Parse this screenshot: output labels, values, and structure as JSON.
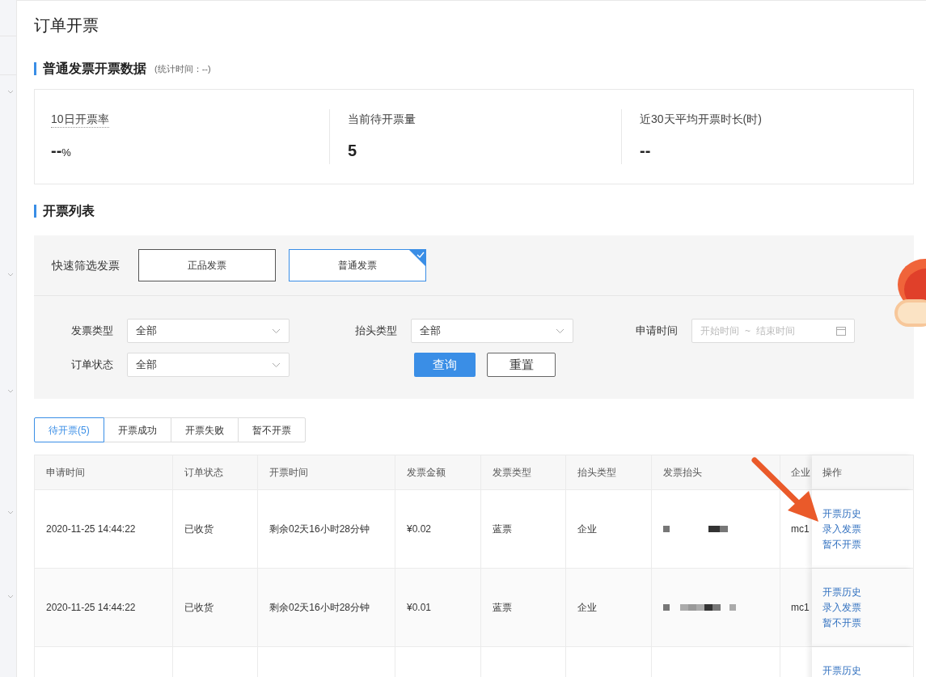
{
  "page_title": "订单开票",
  "stats_section": {
    "title": "普通发票开票数据",
    "note": "(统计时间：--)"
  },
  "stats": [
    {
      "label": "10日开票率",
      "value": "--",
      "unit": "%",
      "has_tooltip": true
    },
    {
      "label": "当前待开票量",
      "value": "5",
      "has_tooltip": false
    },
    {
      "label": "近30天平均开票时长(时)",
      "value": "--",
      "has_tooltip": false
    }
  ],
  "list_section": {
    "title": "开票列表"
  },
  "quick_filter": {
    "label": "快速筛选发票",
    "options": [
      {
        "label": "正品发票",
        "selected": false
      },
      {
        "label": "普通发票",
        "selected": true
      }
    ]
  },
  "filters": [
    {
      "kind": "select",
      "label": "发票类型",
      "value": "全部"
    },
    {
      "kind": "select",
      "label": "抬头类型",
      "value": "全部"
    },
    {
      "kind": "daterange",
      "label": "申请时间",
      "start_placeholder": "开始时间",
      "separator": "~",
      "end_placeholder": "结束时间"
    },
    {
      "kind": "select",
      "label": "订单状态",
      "value": "全部"
    }
  ],
  "buttons": [
    {
      "label": "查询",
      "kind": "primary"
    },
    {
      "label": "重置",
      "kind": "default"
    }
  ],
  "tabs": [
    {
      "label": "待开票(5)",
      "selected": true
    },
    {
      "label": "开票成功",
      "selected": false
    },
    {
      "label": "开票失败",
      "selected": false
    },
    {
      "label": "暂不开票",
      "selected": false
    }
  ],
  "table": {
    "columns": [
      "申请时间",
      "订单状态",
      "开票时间",
      "发票金额",
      "发票类型",
      "抬头类型",
      "发票抬头",
      "企业",
      "操作"
    ],
    "rows": [
      {
        "apply_time": "2020-11-25 14:44:22",
        "order_status": "已收货",
        "invoice_time": "剩余02天16小时28分钟",
        "amount": "¥0.02",
        "invoice_type": "蓝票",
        "title_type": "企业",
        "header_redacted": true,
        "company": "mc1",
        "actions": [
          "开票历史",
          "录入发票",
          "暂不开票"
        ]
      },
      {
        "apply_time": "2020-11-25 14:44:22",
        "order_status": "已收货",
        "invoice_time": "剩余02天16小时28分钟",
        "amount": "¥0.01",
        "invoice_type": "蓝票",
        "title_type": "企业",
        "header_redacted": true,
        "company": "mc1",
        "actions": [
          "开票历史",
          "录入发票",
          "暂不开票"
        ]
      },
      {
        "actions": [
          "开票历史"
        ]
      }
    ]
  }
}
